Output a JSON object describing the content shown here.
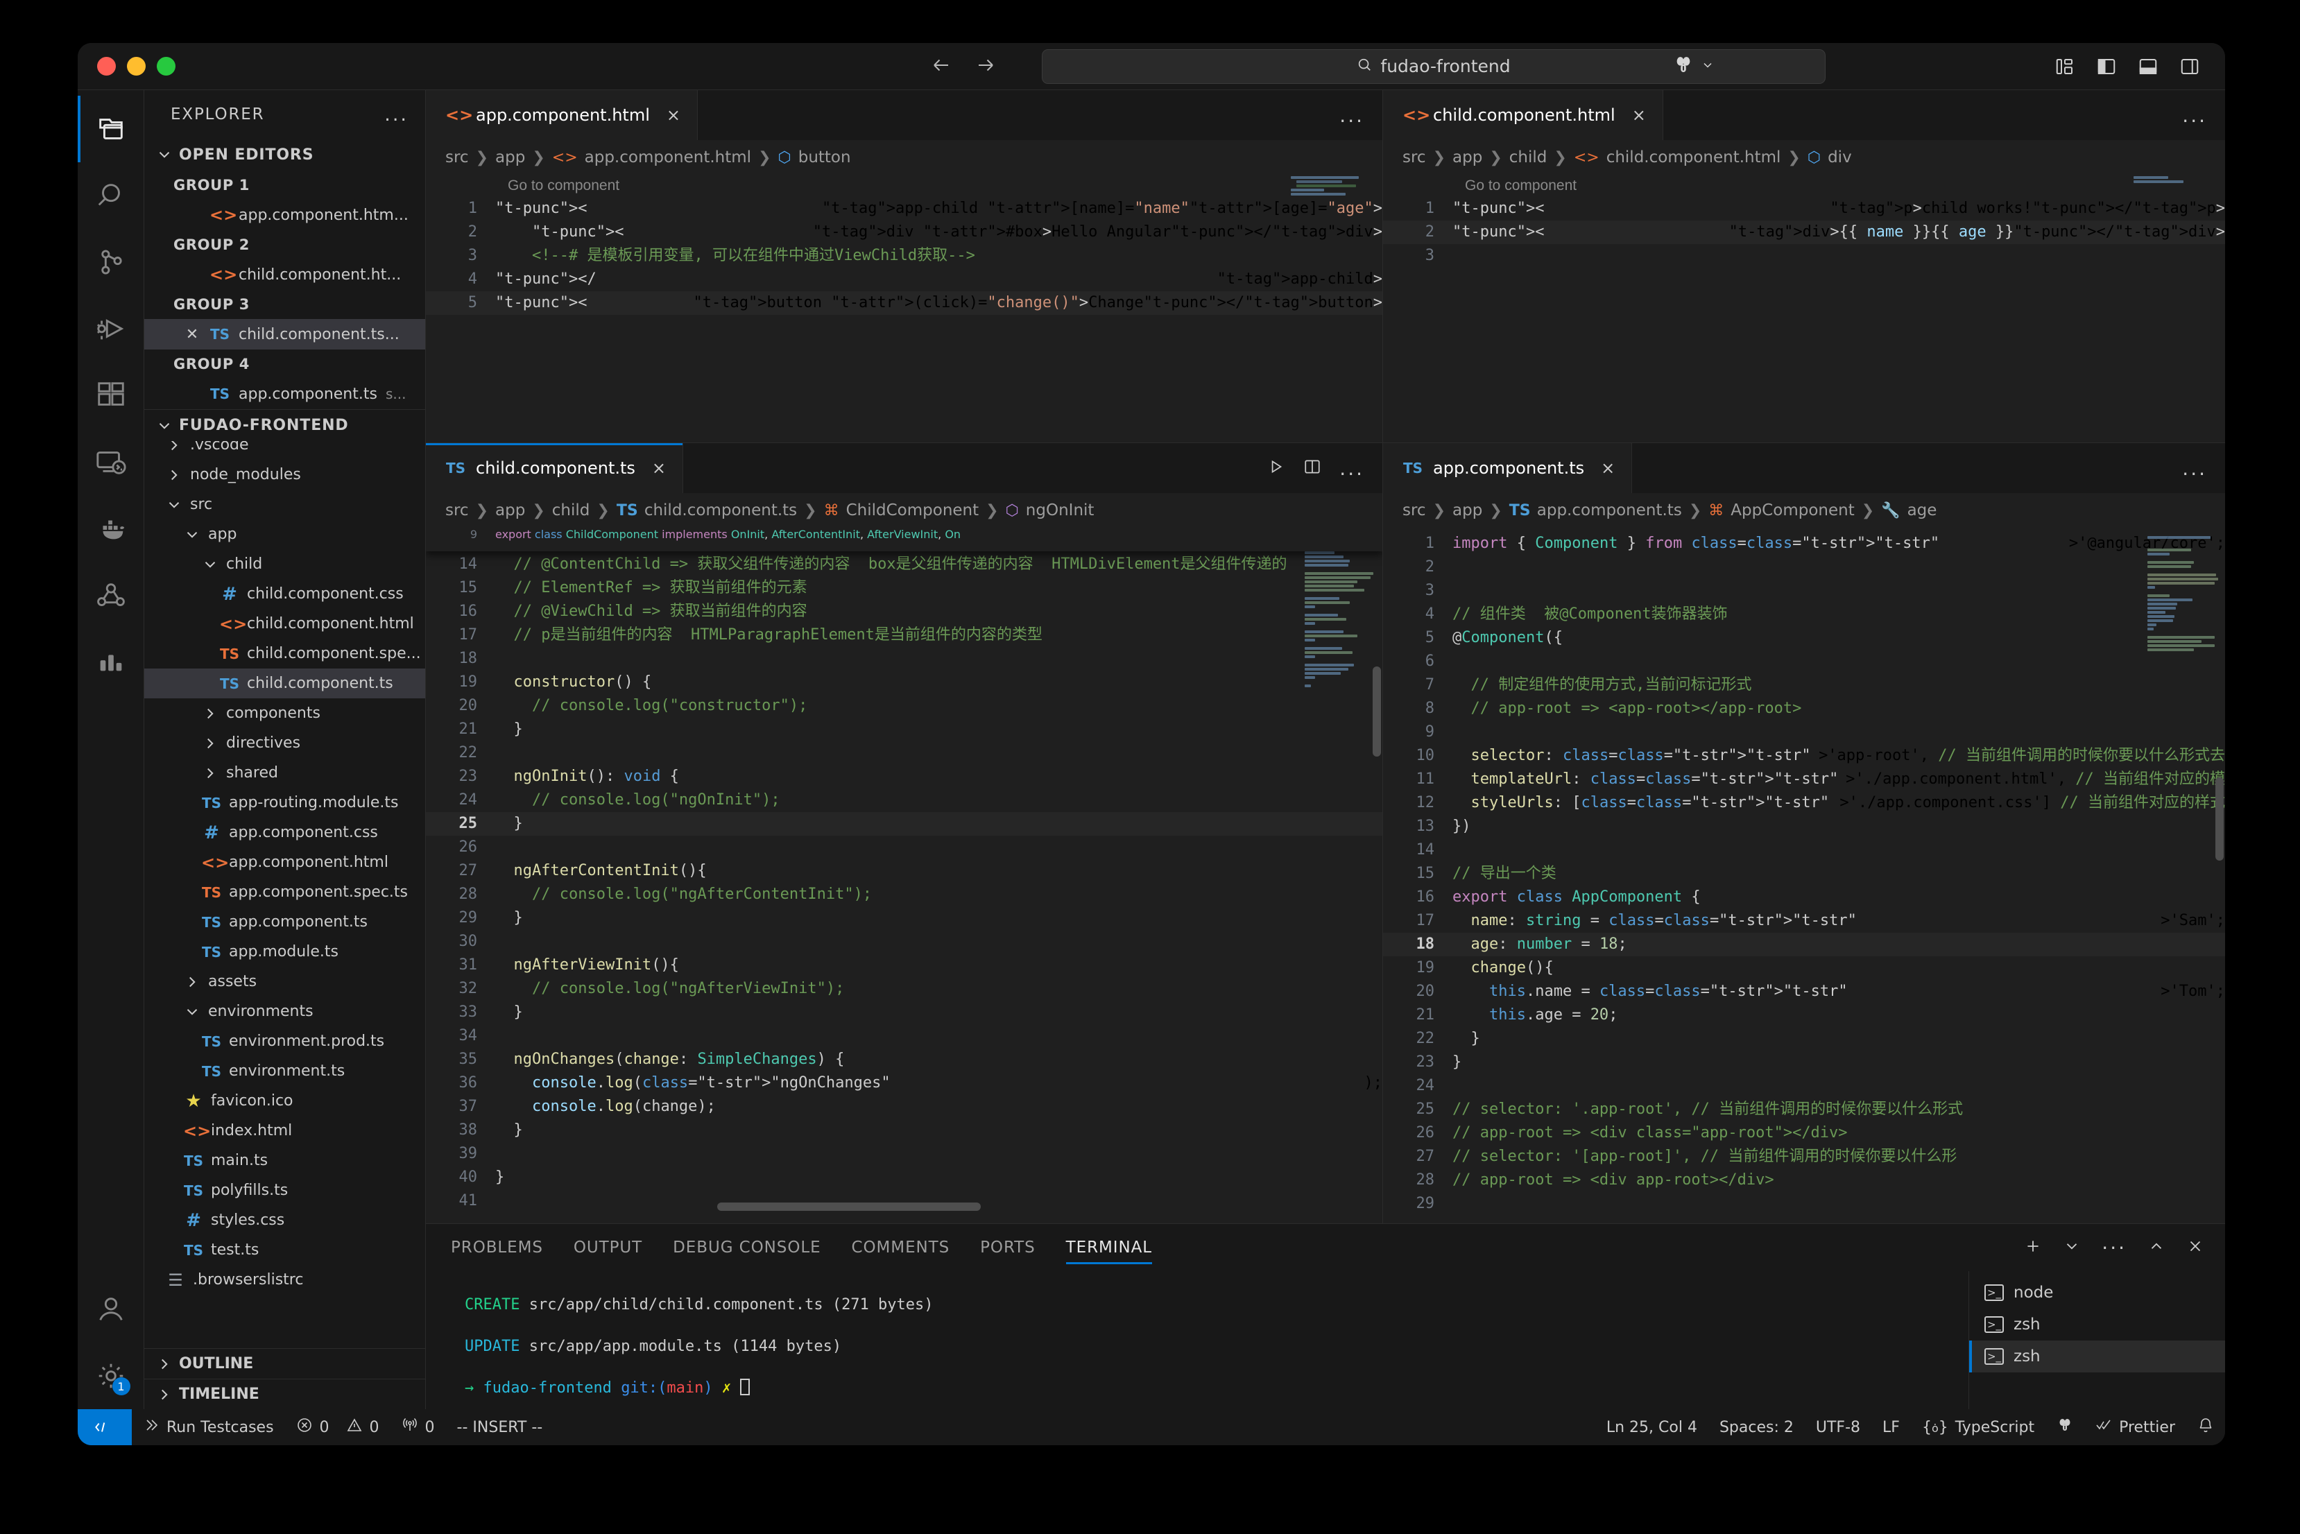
{
  "titlebar": {
    "search_value": "fudao-frontend",
    "search_icon": "search-icon",
    "back_icon": "arrow-left-icon",
    "forward_icon": "arrow-right-icon",
    "remote_icon": "remote-explorer-icon",
    "chevron_icon": "chevron-down-icon",
    "layout_icons": [
      "customize-layout-icon",
      "toggle-primary-sidebar-icon",
      "toggle-panel-icon",
      "toggle-secondary-sidebar-icon"
    ]
  },
  "activitybar": {
    "items": [
      {
        "name": "explorer",
        "icon": "files-icon",
        "active": true
      },
      {
        "name": "search",
        "icon": "search-icon",
        "active": false
      },
      {
        "name": "source-control",
        "icon": "source-control-icon",
        "active": false
      },
      {
        "name": "run-and-debug",
        "icon": "debug-icon",
        "active": false
      },
      {
        "name": "extensions",
        "icon": "extensions-icon",
        "active": false
      },
      {
        "name": "remote-explorer",
        "icon": "remote-monitor-icon",
        "active": false
      },
      {
        "name": "docker",
        "icon": "docker-whale-icon",
        "active": false
      },
      {
        "name": "kubernetes",
        "icon": "kubernetes-icon",
        "active": false
      },
      {
        "name": "test-explorer",
        "icon": "bar-chart-icon",
        "active": false
      }
    ],
    "bottom": [
      {
        "name": "accounts",
        "icon": "account-icon",
        "badge": ""
      },
      {
        "name": "manage",
        "icon": "gear-icon",
        "badge": "1"
      }
    ]
  },
  "sidebar": {
    "title": "EXPLORER",
    "more_label": "...",
    "open_editors": {
      "label": "OPEN EDITORS",
      "groups": [
        {
          "label": "GROUP 1",
          "items": [
            {
              "name": "app.component.htm...",
              "icon": "html",
              "suffix": "",
              "selected": false,
              "close": false
            }
          ]
        },
        {
          "label": "GROUP 2",
          "items": [
            {
              "name": "child.component.ht...",
              "icon": "html",
              "suffix": "",
              "selected": false,
              "close": false
            }
          ]
        },
        {
          "label": "GROUP 3",
          "items": [
            {
              "name": "child.component.ts...",
              "icon": "ts",
              "suffix": "",
              "selected": true,
              "close": true
            }
          ]
        },
        {
          "label": "GROUP 4",
          "items": [
            {
              "name": "app.component.ts",
              "icon": "ts",
              "suffix": "s...",
              "selected": false,
              "close": false
            }
          ]
        }
      ]
    },
    "workspace": {
      "label": "FUDAO-FRONTEND",
      "tree": [
        {
          "label": ".vscode",
          "icon": "folder",
          "depth": 1,
          "state": "collapsed",
          "selected": false
        },
        {
          "label": "node_modules",
          "icon": "folder",
          "depth": 1,
          "state": "collapsed",
          "selected": false
        },
        {
          "label": "src",
          "icon": "folder",
          "depth": 1,
          "state": "expanded",
          "selected": false
        },
        {
          "label": "app",
          "icon": "folder",
          "depth": 2,
          "state": "expanded",
          "selected": false
        },
        {
          "label": "child",
          "icon": "folder",
          "depth": 3,
          "state": "expanded",
          "selected": false
        },
        {
          "label": "child.component.css",
          "icon": "css",
          "depth": 4,
          "state": "file",
          "selected": false
        },
        {
          "label": "child.component.html",
          "icon": "html",
          "depth": 4,
          "state": "file",
          "selected": false
        },
        {
          "label": "child.component.spe...",
          "icon": "tsorange",
          "depth": 4,
          "state": "file",
          "selected": false
        },
        {
          "label": "child.component.ts",
          "icon": "ts",
          "depth": 4,
          "state": "file",
          "selected": true
        },
        {
          "label": "components",
          "icon": "folder",
          "depth": 3,
          "state": "collapsed",
          "selected": false
        },
        {
          "label": "directives",
          "icon": "folder",
          "depth": 3,
          "state": "collapsed",
          "selected": false
        },
        {
          "label": "shared",
          "icon": "folder",
          "depth": 3,
          "state": "collapsed",
          "selected": false
        },
        {
          "label": "app-routing.module.ts",
          "icon": "ts",
          "depth": 3,
          "state": "file",
          "selected": false
        },
        {
          "label": "app.component.css",
          "icon": "css",
          "depth": 3,
          "state": "file",
          "selected": false
        },
        {
          "label": "app.component.html",
          "icon": "html",
          "depth": 3,
          "state": "file",
          "selected": false
        },
        {
          "label": "app.component.spec.ts",
          "icon": "tsorange",
          "depth": 3,
          "state": "file",
          "selected": false
        },
        {
          "label": "app.component.ts",
          "icon": "ts",
          "depth": 3,
          "state": "file",
          "selected": false
        },
        {
          "label": "app.module.ts",
          "icon": "ts",
          "depth": 3,
          "state": "file",
          "selected": false
        },
        {
          "label": "assets",
          "icon": "folder",
          "depth": 2,
          "state": "collapsed",
          "selected": false
        },
        {
          "label": "environments",
          "icon": "folder",
          "depth": 2,
          "state": "expanded",
          "selected": false
        },
        {
          "label": "environment.prod.ts",
          "icon": "ts",
          "depth": 3,
          "state": "file",
          "selected": false
        },
        {
          "label": "environment.ts",
          "icon": "ts",
          "depth": 3,
          "state": "file",
          "selected": false
        },
        {
          "label": "favicon.ico",
          "icon": "star",
          "depth": 2,
          "state": "file",
          "selected": false
        },
        {
          "label": "index.html",
          "icon": "html",
          "depth": 2,
          "state": "file",
          "selected": false
        },
        {
          "label": "main.ts",
          "icon": "ts",
          "depth": 2,
          "state": "file",
          "selected": false
        },
        {
          "label": "polyfills.ts",
          "icon": "ts",
          "depth": 2,
          "state": "file",
          "selected": false
        },
        {
          "label": "styles.css",
          "icon": "css",
          "depth": 2,
          "state": "file",
          "selected": false
        },
        {
          "label": "test.ts",
          "icon": "ts",
          "depth": 2,
          "state": "file",
          "selected": false
        },
        {
          "label": ".browserslistrc",
          "icon": "doc",
          "depth": 1,
          "state": "file",
          "selected": false
        }
      ]
    },
    "outline_label": "OUTLINE",
    "timeline_label": "TIMELINE"
  },
  "editors": {
    "top_left": {
      "tab": {
        "label": "app.component.html",
        "icon": "html-icon",
        "close": "×"
      },
      "breadcrumb": [
        "src",
        "app",
        "app.component.html",
        "button"
      ],
      "hint": "Go to component",
      "lines": [
        {
          "n": "1",
          "t": "<app-child [name]=\"name\" [age]=\"age\">"
        },
        {
          "n": "2",
          "t": "    <div #box>Hello Angular</div>"
        },
        {
          "n": "3",
          "t": "    <!--# 是模板引用变量, 可以在组件中通过ViewChild获取-->"
        },
        {
          "n": "4",
          "t": "</app-child>"
        },
        {
          "n": "5",
          "t": "<button (click)=\"change()\">Change</button>"
        }
      ],
      "more": "..."
    },
    "top_right": {
      "tab": {
        "label": "child.component.html",
        "icon": "html-icon",
        "close": "×"
      },
      "breadcrumb": [
        "src",
        "app",
        "child",
        "child.component.html",
        "div"
      ],
      "hint": "Go to component",
      "lines": [
        {
          "n": "1",
          "t": "<p>child works!</p>"
        },
        {
          "n": "2",
          "t": "<div> {{ name }} {{ age }} </div>"
        },
        {
          "n": "3",
          "t": ""
        }
      ],
      "more": "..."
    },
    "bottom_left": {
      "tab": {
        "label": "child.component.ts",
        "icon": "ts-icon",
        "close": "×"
      },
      "breadcrumb": [
        "src",
        "app",
        "child",
        "child.component.ts",
        "ChildComponent",
        "ngOnInit"
      ],
      "sticky": {
        "n": "9",
        "t": "export class ChildComponent implements OnInit, AfterContentInit, AfterViewInit, On"
      },
      "lines": [
        {
          "n": "14",
          "t": "  // @ContentChild => 获取父组件传递的内容  box是父组件传递的内容  HTMLDivElement是父组件传递的"
        },
        {
          "n": "15",
          "t": "  // ElementRef => 获取当前组件的元素"
        },
        {
          "n": "16",
          "t": "  // @ViewChild => 获取当前组件的内容"
        },
        {
          "n": "17",
          "t": "  // p是当前组件的内容  HTMLParagraphElement是当前组件的内容的类型"
        },
        {
          "n": "18",
          "t": ""
        },
        {
          "n": "19",
          "t": "  constructor() {"
        },
        {
          "n": "20",
          "t": "    // console.log(\"constructor\");"
        },
        {
          "n": "21",
          "t": "  }"
        },
        {
          "n": "22",
          "t": ""
        },
        {
          "n": "23",
          "t": "  ngOnInit(): void {"
        },
        {
          "n": "24",
          "t": "    // console.log(\"ngOnInit\");"
        },
        {
          "n": "25",
          "t": "  }"
        },
        {
          "n": "26",
          "t": ""
        },
        {
          "n": "27",
          "t": "  ngAfterContentInit(){"
        },
        {
          "n": "28",
          "t": "    // console.log(\"ngAfterContentInit\");"
        },
        {
          "n": "29",
          "t": "  }"
        },
        {
          "n": "30",
          "t": ""
        },
        {
          "n": "31",
          "t": "  ngAfterViewInit(){"
        },
        {
          "n": "32",
          "t": "    // console.log(\"ngAfterViewInit\");"
        },
        {
          "n": "33",
          "t": "  }"
        },
        {
          "n": "34",
          "t": ""
        },
        {
          "n": "35",
          "t": "  ngOnChanges(change: SimpleChanges) {"
        },
        {
          "n": "36",
          "t": "    console.log(\"ngOnChanges\");"
        },
        {
          "n": "37",
          "t": "    console.log(change);"
        },
        {
          "n": "38",
          "t": "  }"
        },
        {
          "n": "39",
          "t": ""
        },
        {
          "n": "40",
          "t": "}"
        },
        {
          "n": "41",
          "t": ""
        }
      ],
      "actions": [
        "run-icon",
        "split-editor-icon",
        "more-icon"
      ]
    },
    "bottom_right": {
      "tab": {
        "label": "app.component.ts",
        "icon": "ts-icon",
        "close": "×"
      },
      "breadcrumb": [
        "src",
        "app",
        "app.component.ts",
        "AppComponent",
        "age"
      ],
      "lines": [
        {
          "n": "1",
          "t": "import { Component } from '@angular/core';"
        },
        {
          "n": "2",
          "t": ""
        },
        {
          "n": "3",
          "t": ""
        },
        {
          "n": "4",
          "t": "// 组件类  被@Component装饰器装饰"
        },
        {
          "n": "5",
          "t": "@Component({"
        },
        {
          "n": "6",
          "t": ""
        },
        {
          "n": "7",
          "t": "  // 制定组件的使用方式,当前问标记形式"
        },
        {
          "n": "8",
          "t": "  // app-root => <app-root></app-root>"
        },
        {
          "n": "9",
          "t": ""
        },
        {
          "n": "10",
          "t": "  selector: 'app-root', // 当前组件调用的时候你要以什么形式去"
        },
        {
          "n": "11",
          "t": "  templateUrl: './app.component.html', // 当前组件对应的模"
        },
        {
          "n": "12",
          "t": "  styleUrls: ['./app.component.css'] // 当前组件对应的样式"
        },
        {
          "n": "13",
          "t": "})"
        },
        {
          "n": "14",
          "t": ""
        },
        {
          "n": "15",
          "t": "// 导出一个类"
        },
        {
          "n": "16",
          "t": "export class AppComponent {"
        },
        {
          "n": "17",
          "t": "  name: string = 'Sam';"
        },
        {
          "n": "18",
          "t": "  age: number = 18;"
        },
        {
          "n": "19",
          "t": "  change(){"
        },
        {
          "n": "20",
          "t": "    this.name = 'Tom';"
        },
        {
          "n": "21",
          "t": "    this.age = 20;"
        },
        {
          "n": "22",
          "t": "  }"
        },
        {
          "n": "23",
          "t": "}"
        },
        {
          "n": "24",
          "t": ""
        },
        {
          "n": "25",
          "t": "// selector: '.app-root', // 当前组件调用的时候你要以什么形式"
        },
        {
          "n": "26",
          "t": "// app-root => <div class=\"app-root\"></div>"
        },
        {
          "n": "27",
          "t": "// selector: '[app-root]', // 当前组件调用的时候你要以什么形"
        },
        {
          "n": "28",
          "t": "// app-root => <div app-root></div>"
        },
        {
          "n": "29",
          "t": ""
        }
      ],
      "more": "..."
    }
  },
  "panel": {
    "tabs": [
      {
        "label": "PROBLEMS",
        "active": false
      },
      {
        "label": "OUTPUT",
        "active": false
      },
      {
        "label": "DEBUG CONSOLE",
        "active": false
      },
      {
        "label": "COMMENTS",
        "active": false
      },
      {
        "label": "PORTS",
        "active": false
      },
      {
        "label": "TERMINAL",
        "active": true
      }
    ],
    "actions": [
      "add-terminal-icon",
      "chevron-down-icon",
      "more-icon",
      "maximize-panel-icon",
      "close-panel-icon"
    ],
    "terminal": {
      "lines": [
        {
          "tag": "CREATE",
          "tag_color": "green",
          "rest": " src/app/child/child.component.ts (271 bytes)"
        },
        {
          "tag": "UPDATE",
          "tag_color": "cyan",
          "rest": " src/app/app.module.ts (1144 bytes)"
        }
      ],
      "prompt_arrow": "→",
      "prompt_dir": "fudao-frontend",
      "prompt_git": "git:(",
      "prompt_branch": "main",
      "prompt_git_close": ")",
      "prompt_dirty": "✗"
    },
    "terminal_list": [
      {
        "label": "node",
        "icon": "terminal-icon",
        "active": false
      },
      {
        "label": "zsh",
        "icon": "terminal-icon",
        "active": false
      },
      {
        "label": "zsh",
        "icon": "terminal-icon",
        "active": true
      }
    ]
  },
  "statusbar": {
    "remote_label": "",
    "remote_icon": "remote-icon",
    "run_testcases": "Run Testcases",
    "run_icon": "play-icon",
    "errors": "0",
    "warnings": "0",
    "ports": "0",
    "mode": "-- INSERT --",
    "cursor": "Ln 25, Col 4",
    "spaces": "Spaces: 2",
    "encoding": "UTF-8",
    "eol": "LF",
    "language": "TypeScript",
    "prettier": "Prettier",
    "bell_icon": "bell-icon",
    "error_icon": "error-circle-icon",
    "warn_icon": "warning-triangle-icon",
    "port_icon": "radio-tower-icon",
    "lang_icon": "braces-icon",
    "gremlins_icon": "gremlins-icon",
    "prettier_icon": "checkmark-icon"
  }
}
